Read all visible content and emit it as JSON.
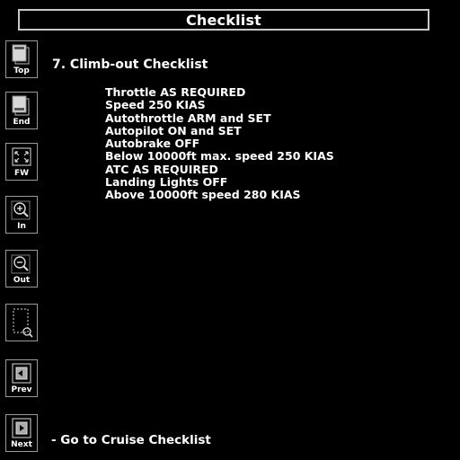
{
  "header": {
    "title": "Checklist"
  },
  "toolbar": {
    "buttons": [
      {
        "label": "Top",
        "icon": "page-top-icon"
      },
      {
        "label": "End",
        "icon": "page-end-icon"
      },
      {
        "label": "FW",
        "icon": "fit-width-icon"
      },
      {
        "label": "In",
        "icon": "zoom-in-icon"
      },
      {
        "label": "Out",
        "icon": "zoom-out-icon"
      },
      {
        "label": "",
        "icon": "page-zoom-icon"
      },
      {
        "label": "Prev",
        "icon": "previous-page-icon"
      },
      {
        "label": "Next",
        "icon": "next-page-icon"
      }
    ]
  },
  "main": {
    "section_title": "7. Climb-out Checklist",
    "items": [
      "Throttle AS REQUIRED",
      "Speed 250 KIAS",
      "Autothrottle ARM and SET",
      "Autopilot ON and SET",
      "Autobrake OFF",
      "Below 10000ft max. speed 250 KIAS",
      "ATC AS REQUIRED",
      "Landing Lights OFF",
      "Above 10000ft speed 280 KIAS"
    ],
    "next_link": "- Go to Cruise Checklist"
  },
  "colors": {
    "background": "#000000",
    "text": "#ffffff",
    "border": "#c8c8c8"
  }
}
